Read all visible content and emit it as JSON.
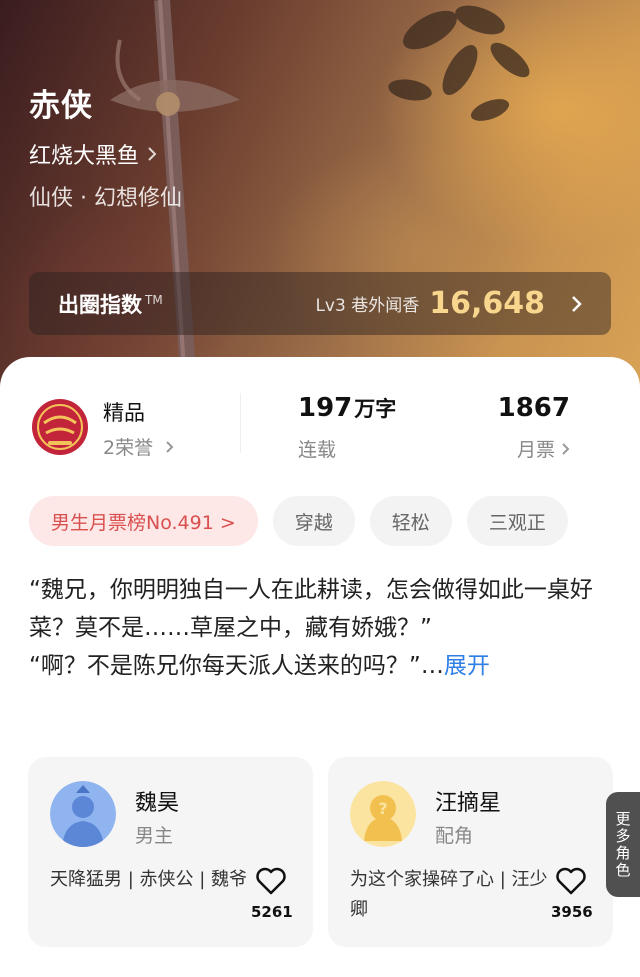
{
  "book": {
    "title": "赤侠",
    "author": "红烧大黑鱼",
    "genre": "仙侠 · 幻想修仙"
  },
  "index_bar": {
    "label": "出圈指数",
    "tm": "TM",
    "level": "Lv3 巷外闻香",
    "value": "16,648"
  },
  "stats": {
    "quality": {
      "title": "精品",
      "sub": "2荣誉"
    },
    "words": {
      "value": "197",
      "unit": "万字",
      "status": "连载"
    },
    "tickets": {
      "value": "1867",
      "label": "月票"
    }
  },
  "tags": [
    {
      "label": "男生月票榜No.491 >"
    },
    {
      "label": "穿越"
    },
    {
      "label": "轻松"
    },
    {
      "label": "三观正"
    }
  ],
  "intro": {
    "para1": "“魏兄，你明明独自一人在此耕读，怎会做得如此一桌好菜？莫不是……草屋之中，藏有娇娥？”",
    "para2": "“啊？不是陈兄你每天派人送来的吗？”…",
    "expand": "展开"
  },
  "roles": [
    {
      "name": "魏昊",
      "type": "男主",
      "desc": "天降猛男 | 赤侠公 | 魏爷",
      "likes": "5261"
    },
    {
      "name": "汪摘星",
      "type": "配角",
      "desc": "为这个家操碎了心 | 汪少卿",
      "likes": "3956"
    }
  ],
  "more_roles": "更多角色",
  "colors": {
    "accent_gold": "#f9d68d",
    "rank_red": "#d9504f",
    "link_blue": "#2f7fe6"
  }
}
